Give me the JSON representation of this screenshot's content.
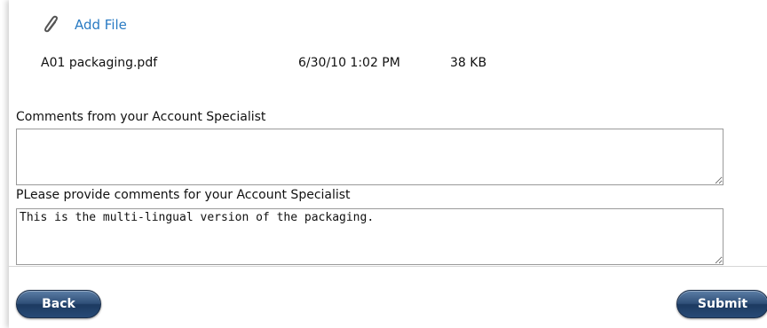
{
  "attachments": {
    "add_file_label": "Add File",
    "add_file_icon": "paperclip-icon",
    "files": [
      {
        "name": "A01 packaging.pdf",
        "date": "6/30/10 1:02 PM",
        "size": "38 KB"
      }
    ]
  },
  "comments": {
    "from_specialist_label": "Comments from your Account Specialist",
    "from_specialist_value": "",
    "to_specialist_label": "PLease provide comments for your Account Specialist",
    "to_specialist_value": "This is the multi-lingual version of the packaging."
  },
  "actions": {
    "back_label": "Back",
    "submit_label": "Submit"
  },
  "colors": {
    "link": "#2a7bc3",
    "button": "#2f4f78"
  }
}
